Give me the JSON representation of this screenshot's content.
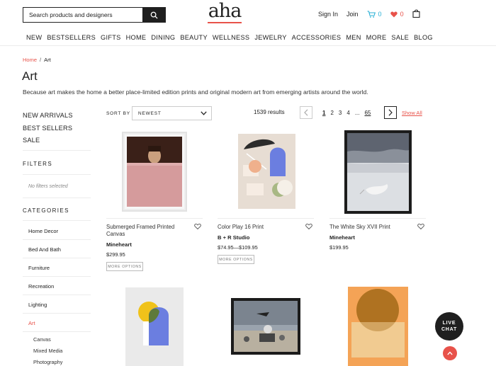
{
  "header": {
    "search_placeholder": "Search products and designers",
    "logo": "aha",
    "sign_in": "Sign In",
    "join": "Join",
    "cart_count": "0",
    "wishlist_count": "0"
  },
  "nav": [
    "NEW",
    "BESTSELLERS",
    "GIFTS",
    "HOME",
    "DINING",
    "BEAUTY",
    "WELLNESS",
    "JEWELRY",
    "ACCESSORIES",
    "MEN",
    "MORE",
    "SALE",
    "BLOG"
  ],
  "breadcrumb": {
    "home": "Home",
    "sep": "/",
    "current": "Art"
  },
  "page": {
    "title": "Art",
    "description": "Because art makes the home a better place-limited edition prints and original modern art from emerging artists around the world."
  },
  "sidebar": {
    "quick_links": [
      "NEW ARRIVALS",
      "BEST SELLERS",
      "SALE"
    ],
    "filters_title": "FILTERS",
    "no_filters": "No filters selected",
    "categories_title": "CATEGORIES",
    "categories": [
      "Home Decor",
      "Bed And Bath",
      "Furniture",
      "Recreation",
      "Lighting",
      "Art"
    ],
    "active_category": "Art",
    "subcategories": [
      "Canvas",
      "Mixed Media",
      "Photography"
    ]
  },
  "toolbar": {
    "sort_label": "SORT BY",
    "sort_value": "NEWEST",
    "results": "1539 results",
    "pages": [
      "1",
      "2",
      "3",
      "4",
      "...",
      "65"
    ],
    "current_page": "1",
    "show_all": "Show All"
  },
  "products": [
    {
      "name": "Submerged Framed Printed Canvas",
      "brand": "Mineheart",
      "price": "$299.95",
      "more_options": "MORE OPTIONS"
    },
    {
      "name": "Color Play 16 Print",
      "brand": "B + R Studio",
      "price": "$74.95—$109.95",
      "more_options": "MORE OPTIONS"
    },
    {
      "name": "The White Sky XVII Print",
      "brand": "Mineheart",
      "price": "$199.95"
    }
  ],
  "floating": {
    "chat_line1": "LIVE",
    "chat_line2": "CHAT"
  },
  "colors": {
    "accent": "#e8524a",
    "cart": "#2ab0d6",
    "dark": "#1f1f1f"
  }
}
